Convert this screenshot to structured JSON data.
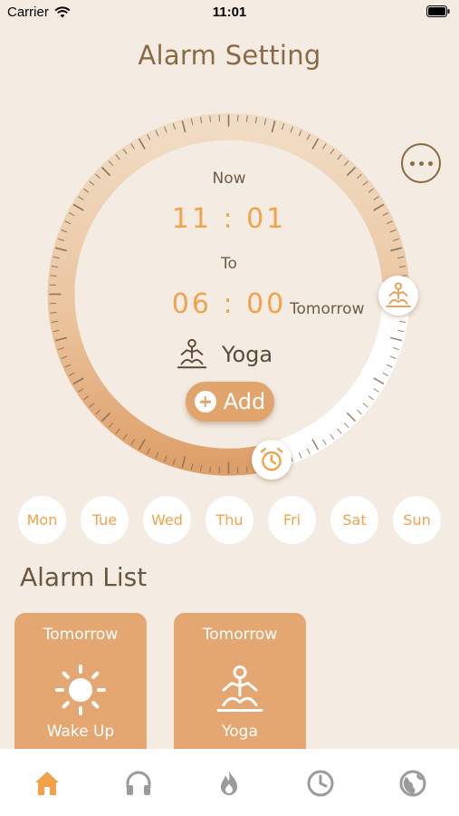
{
  "status_bar": {
    "carrier": "Carrier",
    "time": "11:01"
  },
  "header": {
    "title": "Alarm Setting"
  },
  "clock": {
    "now_label": "Now",
    "now_time": "11 : 01",
    "to_label": "To",
    "to_time": "06 : 00",
    "to_day": "Tomorrow",
    "activity_name": "Yoga",
    "add_label": "Add"
  },
  "days": [
    "Mon",
    "Tue",
    "Wed",
    "Thu",
    "Fri",
    "Sat",
    "Sun"
  ],
  "alarm_list": {
    "title": "Alarm List",
    "items": [
      {
        "when": "Tomorrow",
        "name": "Wake Up",
        "icon": "sun-icon"
      },
      {
        "when": "Tomorrow",
        "name": "Yoga",
        "icon": "yoga-icon"
      }
    ]
  },
  "tabbar": {
    "items": [
      {
        "icon": "home-icon",
        "active": true
      },
      {
        "icon": "headphones-icon",
        "active": false
      },
      {
        "icon": "fire-icon",
        "active": false
      },
      {
        "icon": "clock-icon",
        "active": false
      },
      {
        "icon": "globe-icon",
        "active": false
      }
    ]
  },
  "colors": {
    "background": "#f4ece2",
    "accent": "#f2a24a",
    "card": "#e4a772",
    "title": "#8a6a45"
  }
}
